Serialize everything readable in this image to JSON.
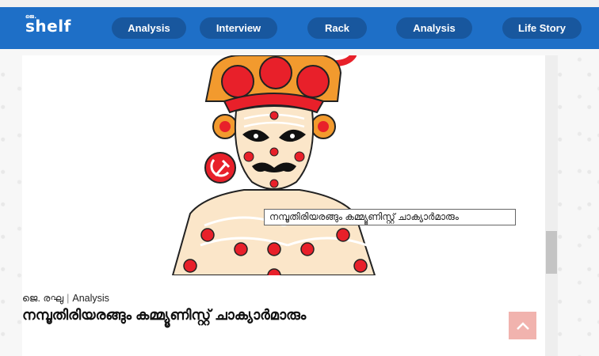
{
  "brand": {
    "prefix": "ജെ.",
    "name": "shelf"
  },
  "nav": {
    "items": [
      {
        "label": "Analysis"
      },
      {
        "label": "Interview"
      },
      {
        "label": "Rack"
      },
      {
        "label": "Analysis"
      },
      {
        "label": "Life Story"
      }
    ]
  },
  "article": {
    "tooltip": "നമ്പൂതിരിയരങ്ങും കമ്മ്യൂണിസ്റ്റ് ചാക്യാർമാരും",
    "author": "ജെ. രഘു",
    "separator": "|",
    "category": "Analysis",
    "title": "നമ്പൂതിരിയരങ്ങും കമ്മ്യൂണിസ്റ്റ് ചാക്യാർമാരും"
  },
  "colors": {
    "header": "#1e6fc7",
    "nav_pill": "#18579e",
    "accent_red": "#e8202a",
    "crown_orange": "#f29a2e",
    "back_to_top": "#f1b3ae"
  },
  "icons": {
    "back_to_top": "chevron-up-icon",
    "hammer_sickle": "hammer-sickle-icon"
  }
}
